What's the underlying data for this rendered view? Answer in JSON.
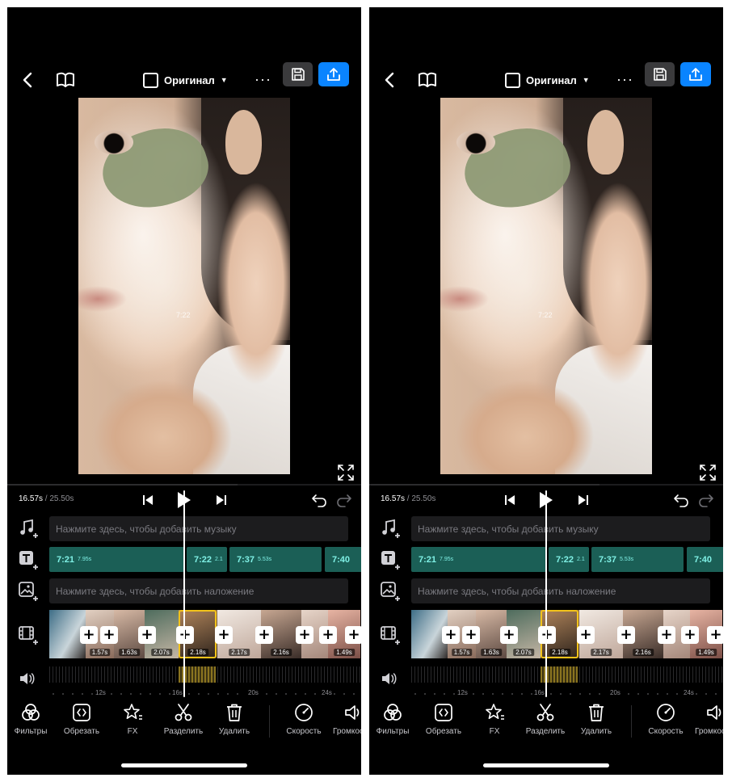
{
  "screens": [
    {
      "topbar": {
        "aspect_label": "Оригинал",
        "more": "···"
      },
      "watermark": "7:22",
      "playback": {
        "current": "16.57s",
        "total": " / 25.50s"
      },
      "tracks": {
        "music_hint": "Нажмите здесь, чтобы добавить музыку",
        "overlay_hint": "Нажмите здесь, чтобы добавить наложение",
        "text_clips": [
          {
            "time": "7:21",
            "dur": "7.95s"
          },
          {
            "time": "7:22",
            "dur": "2.1"
          },
          {
            "time": "7:37",
            "dur": "5.53s"
          },
          {
            "time": "7:40",
            "dur": ""
          }
        ],
        "video_clips": [
          "",
          "1.57s",
          "1.63s",
          "2.07s",
          "2.18s",
          "2.17s",
          "2.16s",
          "",
          "1.49s"
        ],
        "ruler": [
          "12s",
          "16s",
          "20s",
          "24s"
        ]
      },
      "toolbar": [
        "Фильтры",
        "Обрезать",
        "FX",
        "Разделить",
        "Удалить",
        "Скорость",
        "Громкость"
      ]
    },
    {
      "topbar": {
        "aspect_label": "Оригинал",
        "more": "···"
      },
      "watermark": "7:22",
      "playback": {
        "current": "16.57s",
        "total": " / 25.50s"
      },
      "tracks": {
        "music_hint": "Нажмите здесь, чтобы добавить музыку",
        "overlay_hint": "Нажмите здесь, чтобы добавить наложение",
        "text_clips": [
          {
            "time": "7:21",
            "dur": "7.95s"
          },
          {
            "time": "7:22",
            "dur": "2.1"
          },
          {
            "time": "7:37",
            "dur": "5.53s"
          },
          {
            "time": "7:40",
            "dur": ""
          }
        ],
        "video_clips": [
          "",
          "1.57s",
          "1.63s",
          "2.07s",
          "2.18s",
          "2.17s",
          "2.16s",
          "",
          "1.49s"
        ],
        "ruler": [
          "12s",
          "16s",
          "20s",
          "24s"
        ]
      },
      "toolbar": [
        "Фильтры",
        "Обрезать",
        "FX",
        "Разделить",
        "Удалить",
        "Скорость",
        "Громкость"
      ]
    }
  ],
  "colors": {
    "accent": "#0a84ff",
    "selection": "#f2c31b",
    "text_clip": "#1b5f56",
    "text_clip_label": "#7ff0e5"
  },
  "progress_fraction": 0.65
}
